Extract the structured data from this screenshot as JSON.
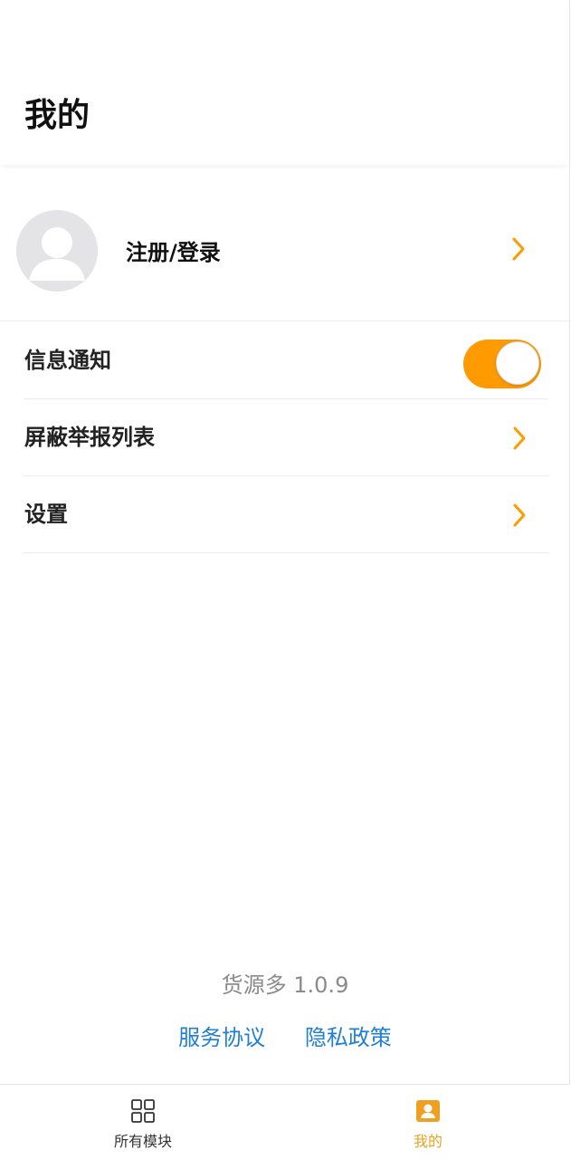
{
  "header": {
    "title": "我的"
  },
  "profile": {
    "login_label": "注册/登录"
  },
  "menu": {
    "items": [
      {
        "label": "信息通知",
        "type": "toggle",
        "enabled": true
      },
      {
        "label": "屏蔽举报列表",
        "type": "link"
      },
      {
        "label": "设置",
        "type": "link"
      }
    ]
  },
  "footer": {
    "version": "货源多 1.0.9",
    "service_agreement": "服务协议",
    "privacy_policy": "隐私政策"
  },
  "tabbar": {
    "tabs": [
      {
        "label": "所有模块",
        "icon": "grid-icon",
        "active": false
      },
      {
        "label": "我的",
        "icon": "user-card-icon",
        "active": true
      }
    ]
  },
  "colors": {
    "accent": "#ff9a00",
    "link": "#1f7fd4",
    "tab_active": "#f0a020",
    "tab_inactive": "#333333"
  }
}
